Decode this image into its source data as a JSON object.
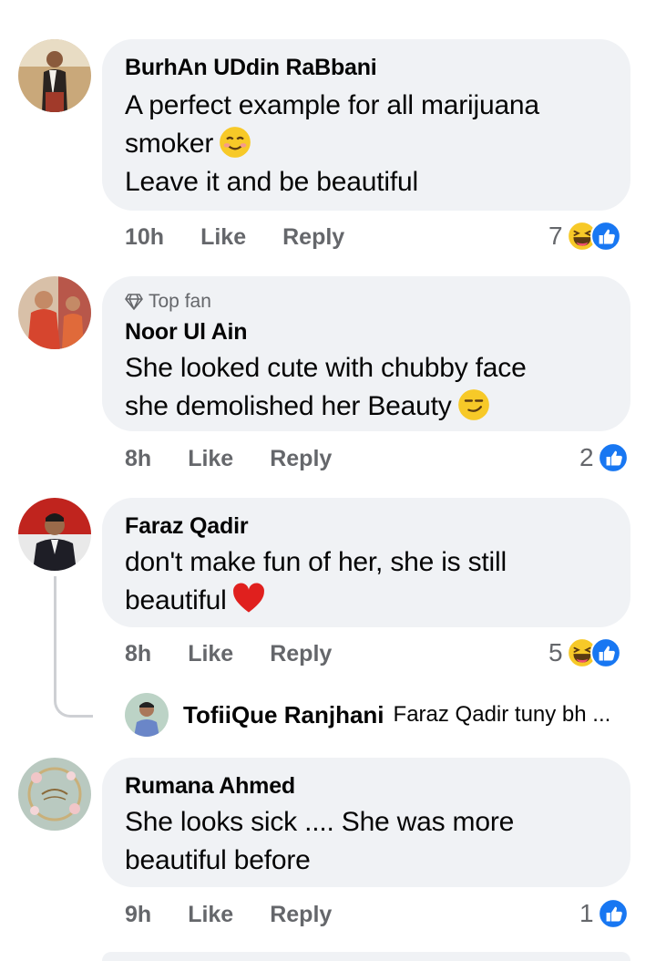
{
  "comments": [
    {
      "author": "BurhAn UDdin RaBbani",
      "lines": [
        "A perfect example for all marijuana",
        "smoker",
        "Leave it and be beautiful"
      ],
      "time": "10h",
      "like": "Like",
      "reply": "Reply",
      "reaction_count": "7",
      "reaction_icons": [
        "haha-icon",
        "like-icon"
      ]
    },
    {
      "badge": "Top fan",
      "author": "Noor Ul Ain",
      "lines": [
        "She looked cute with chubby face",
        "she demolished her Beauty"
      ],
      "time": "8h",
      "like": "Like",
      "reply": "Reply",
      "reaction_count": "2",
      "reaction_icons": [
        "like-icon"
      ]
    },
    {
      "author": "Faraz Qadir",
      "lines": [
        "don't make fun of her, she is still",
        "beautiful"
      ],
      "time": "8h",
      "like": "Like",
      "reply": "Reply",
      "reaction_count": "5",
      "reaction_icons": [
        "haha-icon",
        "like-icon"
      ],
      "reply_preview": {
        "author": "TofiiQue Ranjhani",
        "text": "Faraz Qadir  tuny bh ..."
      }
    },
    {
      "author": "Rumana Ahmed",
      "lines": [
        "She looks sick .... She was more",
        "beautiful before"
      ],
      "time": "9h",
      "like": "Like",
      "reply": "Reply",
      "reaction_count": "1",
      "reaction_icons": [
        "like-icon"
      ]
    }
  ],
  "colors": {
    "bubble": "#f0f2f5",
    "secondary_text": "#65676b",
    "like_blue": "#1877f2",
    "haha_yellow": "#f7c928"
  }
}
